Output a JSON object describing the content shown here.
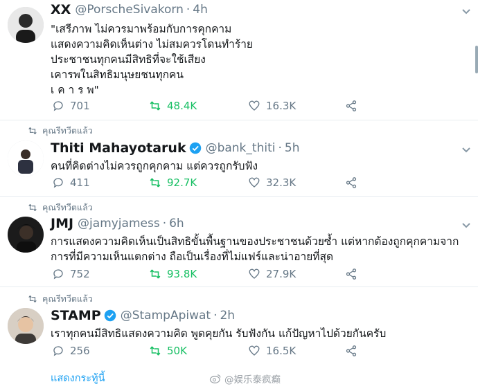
{
  "tweets": [
    {
      "retweet_label": "",
      "name": "XX",
      "verified": false,
      "handle": "@PorscheSivakorn",
      "time": "4h",
      "text": "\"เสรีภาพ ไม่ควรมาพร้อมกับการคุกคาม\nแสดงความคิดเห็นต่าง ไม่สมควรโดนทำร้าย\nประชาชนทุกคนมีสิทธิที่จะใช้เสียง\nเคารพในสิทธิมนุษยชนทุกคน\nเ ค า ร พ\"",
      "replies": "701",
      "retweets": "48.4K",
      "likes": "16.3K"
    },
    {
      "retweet_label": "คุณรีทวีตแล้ว",
      "name": "Thiti Mahayotaruk",
      "verified": true,
      "handle": "@bank_thiti",
      "time": "5h",
      "text": "คนที่คิดต่างไม่ควรถูกคุกคาม แต่ควรถูกรับฟัง",
      "replies": "411",
      "retweets": "92.7K",
      "likes": "32.3K"
    },
    {
      "retweet_label": "คุณรีทวีตแล้ว",
      "name": "JMJ",
      "verified": false,
      "handle": "@jamyjamess",
      "time": "6h",
      "text": "การแสดงความคิดเห็นเป็นสิทธิขั้นพื้นฐานของประชาชนด้วยซ้ำ แต่หากต้องถูกคุกคามจาก\nการที่มีความเห็นแตกต่าง ถือเป็นเรื่องที่ไม่แฟร์และน่าอายที่สุด",
      "replies": "752",
      "retweets": "93.8K",
      "likes": "27.9K"
    },
    {
      "retweet_label": "คุณรีทวีตแล้ว",
      "name": "STAMP",
      "verified": true,
      "handle": "@StampApiwat",
      "time": "2h",
      "text": "เราทุกคนมีสิทธิแสดงความคิด พูดคุยกัน รับฟังกัน แก้ปัญหาไปด้วยกันครับ",
      "replies": "256",
      "retweets": "50K",
      "likes": "16.5K"
    }
  ],
  "show_more": "แสดงกระทู้นี้",
  "watermark": "@娱乐泰疯癫",
  "colors": {
    "accent": "#1da1f2",
    "retweet": "#17bf63",
    "muted": "#657786"
  }
}
